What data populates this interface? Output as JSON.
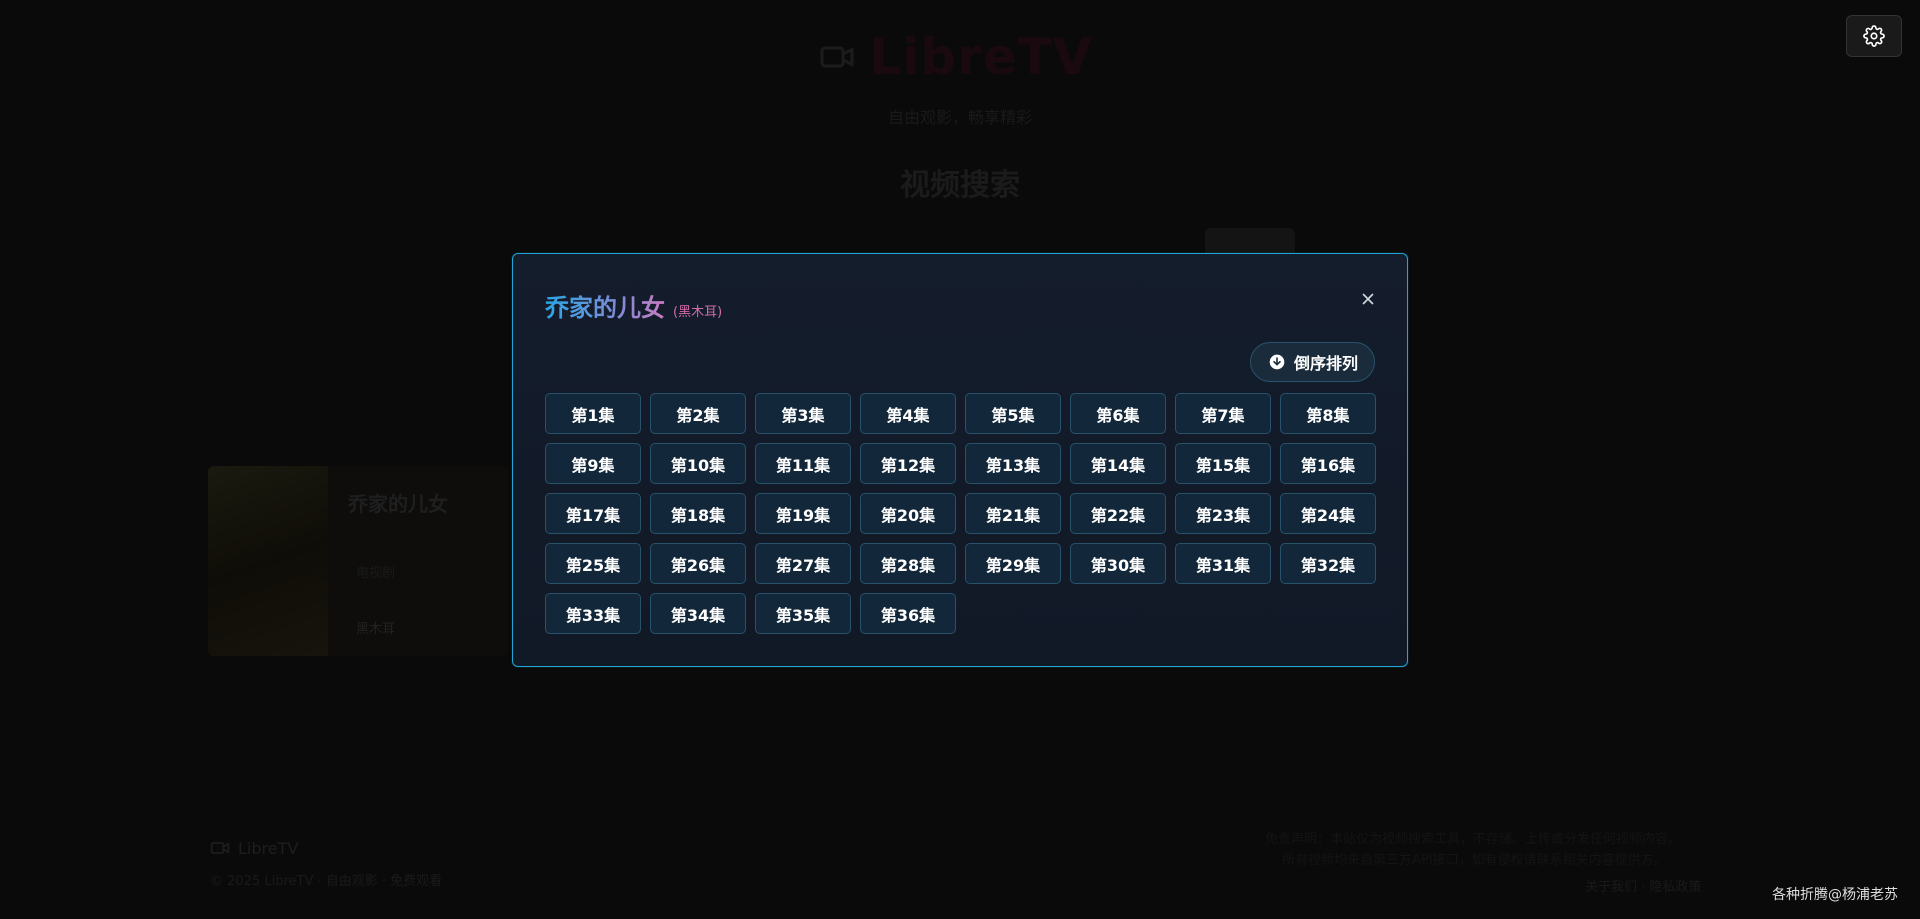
{
  "app": {
    "title": "LibreTV",
    "subtitle": "自由观影，畅享精彩",
    "search_title": "视频搜索"
  },
  "result_card": {
    "title": "乔家的儿女",
    "meta": "电视剧",
    "source": "黑木耳"
  },
  "footer": {
    "logo_text": "LibreTV",
    "copyright": "© 2025 LibreTV · 自由观影 · 免费观看",
    "note_line1": "免责声明：本站仅为视频搜索工具，不存储、上传或分发任何视频内容。",
    "note_line2": "所有视频均来自第三方API接口，如有侵权请联系相关内容提供方。",
    "links": "关于我们 · 隐私政策",
    "watermark": "各种折腾@杨浦老苏"
  },
  "modal": {
    "title": "乔家的儿女",
    "source": "(黑木耳)",
    "sort_label": "倒序排列",
    "episodes": [
      "第1集",
      "第2集",
      "第3集",
      "第4集",
      "第5集",
      "第6集",
      "第7集",
      "第8集",
      "第9集",
      "第10集",
      "第11集",
      "第12集",
      "第13集",
      "第14集",
      "第15集",
      "第16集",
      "第17集",
      "第18集",
      "第19集",
      "第20集",
      "第21集",
      "第22集",
      "第23集",
      "第24集",
      "第25集",
      "第26集",
      "第27集",
      "第28集",
      "第29集",
      "第30集",
      "第31集",
      "第32集",
      "第33集",
      "第34集",
      "第35集",
      "第36集"
    ]
  },
  "icons": {
    "settings": "gear-icon",
    "close": "close-icon",
    "sort": "arrow-down-circle-icon",
    "logo": "video-camera-icon"
  },
  "colors": {
    "accent": "#1da8d6",
    "title_gradient_start": "#2ba6e6",
    "title_gradient_end": "#c97bc0",
    "source_text": "#d06aa8",
    "episode_bg": "#13273a"
  }
}
